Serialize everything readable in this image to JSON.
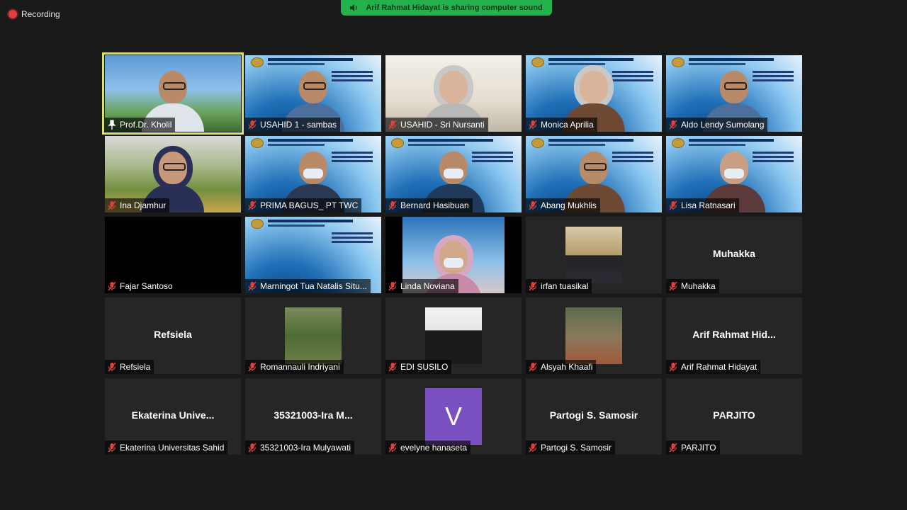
{
  "recording": {
    "label": "Recording"
  },
  "share_banner": {
    "text": "Arif Rahmat Hidayat is sharing computer sound",
    "icon": "speaker-icon"
  },
  "colors": {
    "muted": "#e0403c",
    "active_border": "#d9e07a",
    "banner": "#23b14d",
    "tile_bg": "#262626",
    "avatar_purple": "#7a4fbf"
  },
  "participants": [
    {
      "name": "Prof.Dr. Kholil",
      "status": "pinned",
      "view": "video"
    },
    {
      "name": "USAHID 1 - sambas",
      "status": "muted",
      "view": "video"
    },
    {
      "name": "USAHID - Sri Nursanti",
      "status": "muted",
      "view": "video"
    },
    {
      "name": "Monica Aprilia",
      "status": "muted",
      "view": "video"
    },
    {
      "name": "Aldo Lendy Sumolang",
      "status": "muted",
      "view": "video"
    },
    {
      "name": "Ina Djamhur",
      "status": "muted",
      "view": "video"
    },
    {
      "name": "PRIMA BAGUS_ PT TWC",
      "status": "muted",
      "view": "video"
    },
    {
      "name": "Bernard Hasibuan",
      "status": "muted",
      "view": "video"
    },
    {
      "name": "Abang Mukhlis",
      "status": "muted",
      "view": "video"
    },
    {
      "name": "Lisa Ratnasari",
      "status": "muted",
      "view": "video"
    },
    {
      "name": "Fajar Santoso",
      "status": "muted",
      "view": "video"
    },
    {
      "name": "Marningot Tua Natalis Situ...",
      "status": "muted",
      "view": "video"
    },
    {
      "name": "Linda Noviana",
      "status": "muted",
      "view": "video"
    },
    {
      "name": "irfan tuasikal",
      "status": "muted",
      "view": "photo"
    },
    {
      "name": "Muhakka",
      "display": "Muhakka",
      "status": "muted",
      "view": "name"
    },
    {
      "name": "Refsiela",
      "display": "Refsiela",
      "status": "muted",
      "view": "name"
    },
    {
      "name": "Romannauli Indriyani",
      "status": "muted",
      "view": "photo"
    },
    {
      "name": "EDI SUSILO",
      "status": "muted",
      "view": "photo"
    },
    {
      "name": "Alsyah Khaafi",
      "status": "muted",
      "view": "photo"
    },
    {
      "name": "Arif Rahmat Hidayat",
      "display": "Arif  Rahmat  Hid...",
      "status": "muted",
      "view": "name"
    },
    {
      "name": "Ekaterina Universitas Sahid",
      "display": "Ekaterina  Unive...",
      "status": "muted",
      "view": "name"
    },
    {
      "name": "35321003-Ira Mulyawati",
      "display": "35321003-Ira  M...",
      "status": "muted",
      "view": "name"
    },
    {
      "name": "evelyne hanaseta",
      "avatar": "V",
      "status": "muted",
      "view": "avatar"
    },
    {
      "name": "Partogi S. Samosir",
      "display": "Partogi S. Samosir",
      "status": "muted",
      "view": "name"
    },
    {
      "name": "PARJITO",
      "display": "PARJITO",
      "status": "muted",
      "view": "name"
    }
  ]
}
